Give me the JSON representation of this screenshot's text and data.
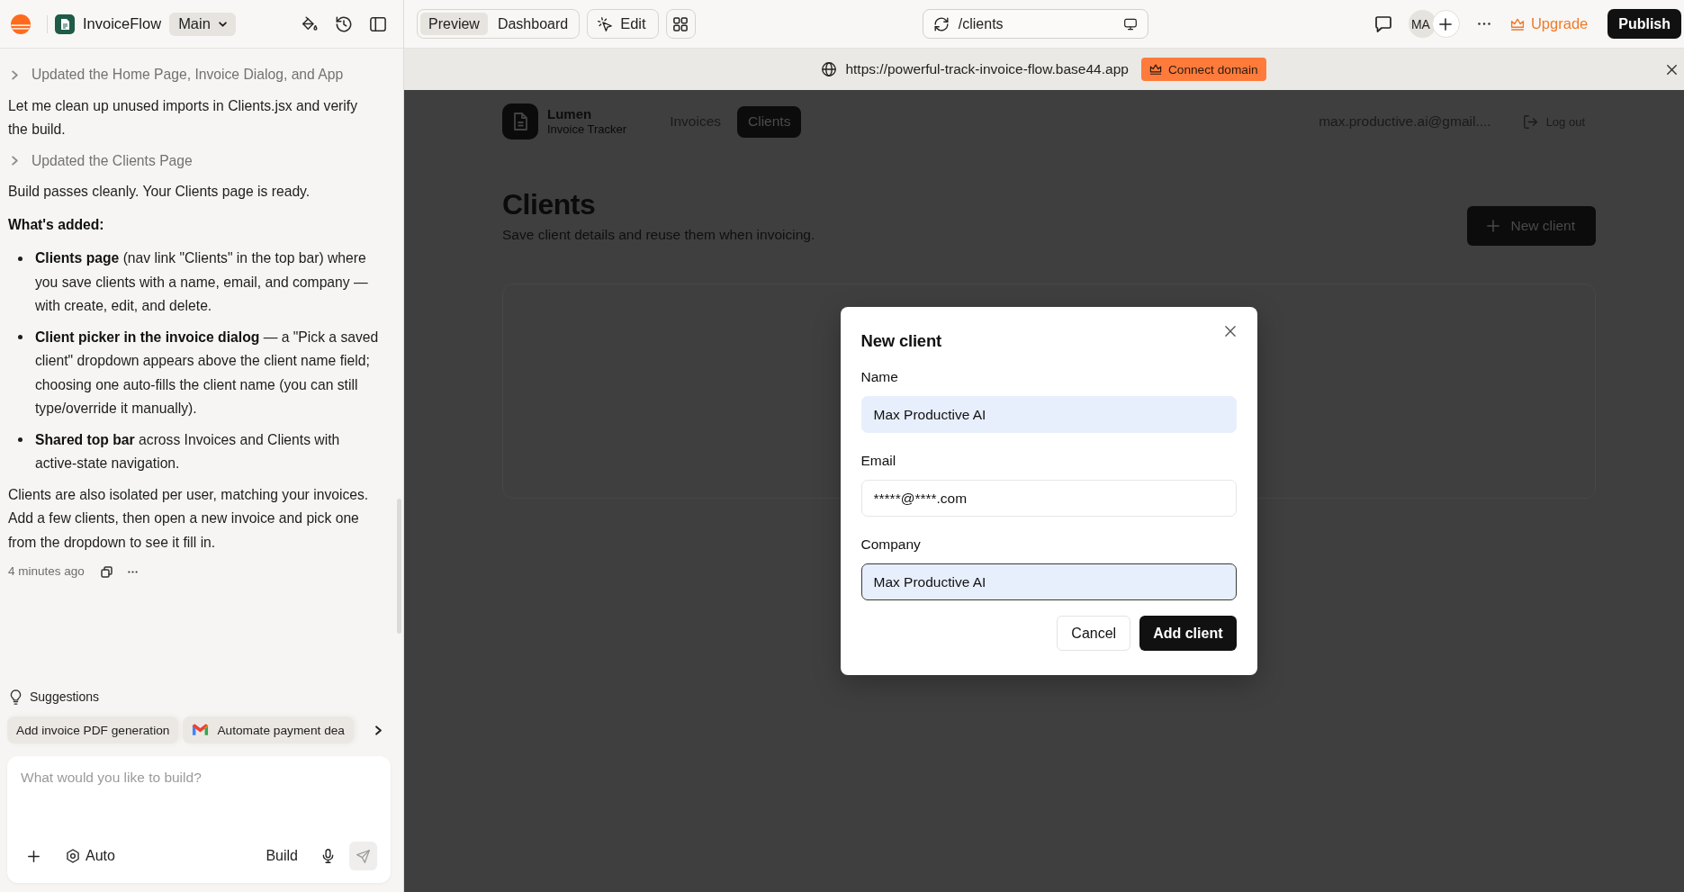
{
  "app_bar": {
    "name": "InvoiceFlow",
    "branch": "Main"
  },
  "toolbar": {
    "view_tabs": [
      {
        "label": "Preview",
        "selected": true
      },
      {
        "label": "Dashboard",
        "selected": false
      }
    ],
    "edit": "Edit",
    "address": "/clients",
    "initials": "MA",
    "upgrade": "Upgrade",
    "publish": "Publish"
  },
  "chat": {
    "messages": [
      {
        "kind": "step",
        "text": "Updated the Home Page, Invoice Dialog, and App",
        "expanded": false
      },
      {
        "kind": "text",
        "text": "Let me clean up unused imports in Clients.jsx and verify the build."
      },
      {
        "kind": "step",
        "text": "Updated the Clients Page",
        "expanded": false
      },
      {
        "kind": "text",
        "text": "Build passes cleanly. Your Clients page is ready."
      },
      {
        "kind": "heading",
        "text": "What's added:"
      },
      {
        "kind": "bullets",
        "items": [
          "**Clients page** (nav link \"Clients\" in the top bar) where you save clients with a name, email, and company — with create, edit, and delete.",
          "**Client picker in the invoice dialog** — a \"Pick a saved client\" dropdown appears above the client name field; choosing one auto-fills the client name (you can still type/override it manually).",
          "**Shared top bar** across Invoices and Clients with active-state navigation."
        ]
      },
      {
        "kind": "text",
        "text": "Clients are also isolated per user, matching your invoices. Add a few clients, then open a new invoice and pick one from the dropdown to see it fill in."
      }
    ],
    "timestamp": "4 minutes ago"
  },
  "suggestions": {
    "title": "Suggestions",
    "chips": [
      {
        "label": "Add invoice PDF generation",
        "kind": "plain"
      },
      {
        "label": "Automate payment dea",
        "kind": "mail"
      }
    ]
  },
  "composer": {
    "placeholder": "What would you like to build?",
    "mode": "Auto",
    "action": "Build"
  },
  "preview_bar": {
    "url": "https://powerful-track-invoice-flow.base44.app",
    "connect": "Connect domain"
  },
  "site": {
    "brand": "Lumen",
    "tagline": "Invoice Tracker",
    "nav": [
      {
        "label": "Invoices",
        "selected": false
      },
      {
        "label": "Clients",
        "selected": true
      }
    ],
    "user_email": "max.productive.ai@gmail....",
    "logout": "Log out",
    "title": "Clients",
    "subtitle": "Save client details and reuse them when invoicing.",
    "new_button": "New client"
  },
  "dialog": {
    "title": "New client",
    "fields": [
      {
        "label": "Name",
        "value": "Max Productive AI",
        "autofilled": true,
        "focused": false
      },
      {
        "label": "Email",
        "value": "*****@****.com",
        "autofilled": false,
        "focused": false
      },
      {
        "label": "Company",
        "value": "Max Productive AI",
        "autofilled": true,
        "focused": true
      }
    ],
    "buttons": [
      {
        "label": "Cancel",
        "kind": "secondary"
      },
      {
        "label": "Add client",
        "kind": "primary"
      }
    ]
  }
}
